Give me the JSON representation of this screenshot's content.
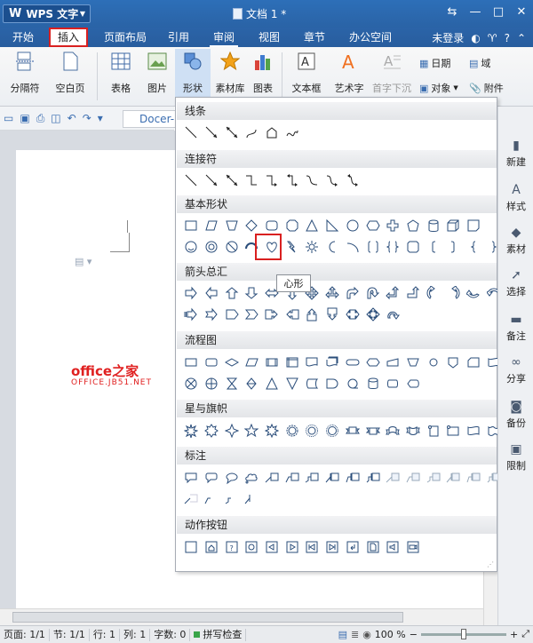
{
  "app": {
    "name": "WPS 文字",
    "doc_title": "文档 1 *"
  },
  "tabs": [
    {
      "label": "开始"
    },
    {
      "label": "插入"
    },
    {
      "label": "页面布局"
    },
    {
      "label": "引用"
    },
    {
      "label": "审阅"
    },
    {
      "label": "视图"
    },
    {
      "label": "章节"
    },
    {
      "label": "办公空间"
    }
  ],
  "account": {
    "label": "未登录"
  },
  "ribbon": {
    "page_break": "分隔符",
    "blank_page": "空白页",
    "table": "表格",
    "picture": "图片",
    "shapes": "形状",
    "material": "素材库",
    "chart": "图表",
    "textbox": "文本框",
    "wordart": "艺术字",
    "dropcap": "首字下沉",
    "date": "日期",
    "field": "域",
    "object": "对象",
    "attachment": "附件"
  },
  "doc_tab": {
    "label": "Docer-"
  },
  "watermark": {
    "line1": "office之家",
    "line2": "OFFICE.JB51.NET"
  },
  "shapes_menu": {
    "sections": [
      "线条",
      "连接符",
      "基本形状",
      "箭头总汇",
      "流程图",
      "星与旗帜",
      "标注",
      "动作按钮"
    ],
    "tooltip": "心形"
  },
  "right_panel": [
    {
      "label": "新建"
    },
    {
      "label": "样式"
    },
    {
      "label": "素材"
    },
    {
      "label": "选择"
    },
    {
      "label": "备注"
    },
    {
      "label": "分享"
    },
    {
      "label": "备份"
    },
    {
      "label": "限制"
    }
  ],
  "status": {
    "page": "页面: 1/1",
    "section": "节: 1/1",
    "row": "行: 1",
    "col": "列: 1",
    "words": "字数: 0",
    "spell": "拼写检查",
    "zoom": "100 %",
    "zoom_level": 0.5
  }
}
